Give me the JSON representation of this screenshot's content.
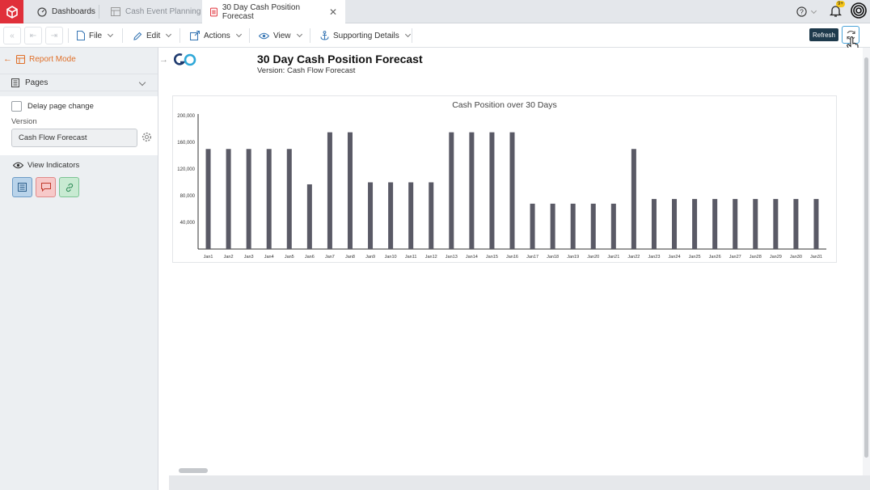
{
  "tabs": [
    {
      "label": "Dashboards",
      "icon": "dashboard-icon",
      "state": "normal"
    },
    {
      "label": "Cash Event Planning",
      "icon": "table-icon",
      "state": "inactive"
    },
    {
      "label": "30 Day Cash Position Forecast",
      "icon": "report-icon",
      "state": "active"
    }
  ],
  "header": {
    "notification_badge": "9+"
  },
  "toolbar": {
    "file": "File",
    "edit": "Edit",
    "actions": "Actions",
    "view": "View",
    "supporting": "Supporting Details",
    "refresh_tooltip": "Refresh"
  },
  "sidebar": {
    "report_mode": "Report Mode",
    "pages": "Pages",
    "delay_page_change": "Delay page change",
    "version_label": "Version",
    "version_value": "Cash Flow Forecast",
    "view_indicators": "View Indicators"
  },
  "report": {
    "title": "30 Day Cash Position Forecast",
    "subtitle": "Version: Cash Flow Forecast"
  },
  "colors": {
    "accent": "#e0702a",
    "bar": "#5a5a66",
    "brand": "#e0303a"
  },
  "chart_data": {
    "type": "bar",
    "title": "Cash Position over 30 Days",
    "xlabel": "",
    "ylabel": "",
    "ylim": [
      0,
      200000
    ],
    "yticks": [
      40000,
      80000,
      120000,
      160000,
      200000
    ],
    "ytick_labels": [
      "40,000",
      "80,000",
      "120,000",
      "160,000",
      "200,000"
    ],
    "grid": false,
    "categories": [
      "Jan1",
      "Jan2",
      "Jan3",
      "Jan4",
      "Jan5",
      "Jan6",
      "Jan7",
      "Jan8",
      "Jan9",
      "Jan10",
      "Jan11",
      "Jan12",
      "Jan13",
      "Jan14",
      "Jan15",
      "Jan16",
      "Jan17",
      "Jan18",
      "Jan19",
      "Jan20",
      "Jan21",
      "Jan22",
      "Jan23",
      "Jan24",
      "Jan25",
      "Jan26",
      "Jan27",
      "Jan28",
      "Jan29",
      "Jan30",
      "Jan31"
    ],
    "values": [
      150000,
      150000,
      150000,
      150000,
      150000,
      97000,
      175000,
      175000,
      100000,
      100000,
      100000,
      100000,
      175000,
      175000,
      175000,
      175000,
      68000,
      68000,
      68000,
      68000,
      68000,
      150000,
      75000,
      75000,
      75000,
      75000,
      75000,
      75000,
      75000,
      75000,
      75000
    ]
  }
}
